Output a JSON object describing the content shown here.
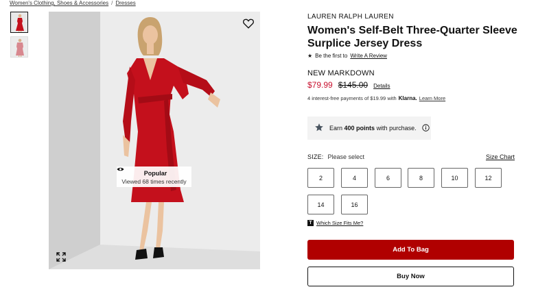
{
  "breadcrumb": {
    "items": [
      "Women's Clothing, Shoes & Accessories",
      "Dresses"
    ],
    "separator": "/"
  },
  "gallery": {
    "thumbnails": [
      "dress-front-thumbnail",
      "dress-back-thumbnail"
    ],
    "popular": {
      "title": "Popular",
      "subtitle": "Viewed 68 times recently"
    }
  },
  "product": {
    "brand": "LAUREN RALPH LAUREN",
    "title": "Women's Self-Belt Three-Quarter Sleeve Surplice Jersey Dress",
    "review_prefix": "Be the first to",
    "review_link": "Write A Review",
    "markdown_label": "NEW MARKDOWN",
    "sale_price": "$79.99",
    "original_price": "$145.00",
    "details_link": "Details",
    "klarna_text": "4 interest-free payments of $19.99 with",
    "klarna_brand": "Klarna.",
    "klarna_learn": "Learn More",
    "points_prefix": "Earn",
    "points_value": "400 points",
    "points_suffix": "with purchase."
  },
  "size": {
    "label": "SIZE:",
    "placeholder": "Please select",
    "chart_link": "Size Chart",
    "options": [
      "2",
      "4",
      "6",
      "8",
      "10",
      "12",
      "14",
      "16"
    ],
    "fit_icon": "T",
    "fit_link": "Which Size Fits Me?"
  },
  "actions": {
    "add_to_bag": "Add To Bag",
    "buy_now": "Buy Now"
  },
  "colors": {
    "sale": "#c8102e",
    "add_to_bag_bg": "#b00000",
    "dress": "#c4101c"
  }
}
